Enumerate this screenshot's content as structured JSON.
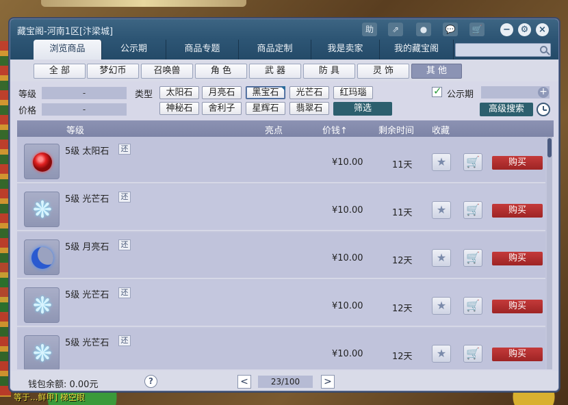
{
  "window": {
    "title": "藏宝阁-河南1区[汴梁城]"
  },
  "titlebar_icons": [
    "help-icon",
    "share-icon",
    "stop-icon",
    "chat-icon",
    "cart-icon"
  ],
  "titlebar_help_label": "助",
  "tabs": [
    {
      "label": "浏览商品",
      "active": true
    },
    {
      "label": "公示期"
    },
    {
      "label": "商品专题"
    },
    {
      "label": "商品定制"
    },
    {
      "label": "我是卖家"
    },
    {
      "label": "我的藏宝阁"
    }
  ],
  "search": {
    "placeholder": ""
  },
  "categories": [
    {
      "label": "全 部"
    },
    {
      "label": "梦幻币"
    },
    {
      "label": "召唤兽"
    },
    {
      "label": "角 色"
    },
    {
      "label": "武 器"
    },
    {
      "label": "防 具"
    },
    {
      "label": "灵 饰"
    },
    {
      "label": "其 他",
      "active": true
    }
  ],
  "filters": {
    "level_label": "等级",
    "level_value": "-",
    "price_label": "价格",
    "price_value": "-",
    "type_label": "类型",
    "types": [
      "太阳石",
      "月亮石",
      "黑宝石",
      "光芒石",
      "红玛瑙",
      "神秘石",
      "舍利子",
      "星辉石",
      "翡翠石"
    ],
    "selected_type": "黑宝石",
    "filter_button": "筛选",
    "public_period_label": "公示期",
    "public_period_checked": true,
    "advanced_search": "高级搜索"
  },
  "table": {
    "headers": {
      "level": "等级",
      "highlight": "亮点",
      "price": "价钱↑",
      "remaining": "剩余时间",
      "favorite": "收藏"
    },
    "rows": [
      {
        "icon": "sun-stone-icon",
        "name": "5级 太阳石",
        "badge": "还",
        "price": "¥10.00",
        "remaining": "11天",
        "buy": "购买"
      },
      {
        "icon": "light-stone-icon",
        "name": "5级 光芒石",
        "badge": "还",
        "price": "¥10.00",
        "remaining": "11天",
        "buy": "购买"
      },
      {
        "icon": "moon-stone-icon",
        "name": "5级 月亮石",
        "badge": "还",
        "price": "¥10.00",
        "remaining": "12天",
        "buy": "购买"
      },
      {
        "icon": "light-stone-icon",
        "name": "5级 光芒石",
        "badge": "还",
        "price": "¥10.00",
        "remaining": "12天",
        "buy": "购买"
      },
      {
        "icon": "light-stone-icon",
        "name": "5级 光芒石",
        "badge": "还",
        "price": "¥10.00",
        "remaining": "12天",
        "buy": "购买"
      }
    ]
  },
  "footer": {
    "balance": "钱包余额:  0.00元",
    "help": "?",
    "prev": "<",
    "page": "23/100",
    "next": ">"
  },
  "background_text": "等于...鲜甲] 梯空眼"
}
